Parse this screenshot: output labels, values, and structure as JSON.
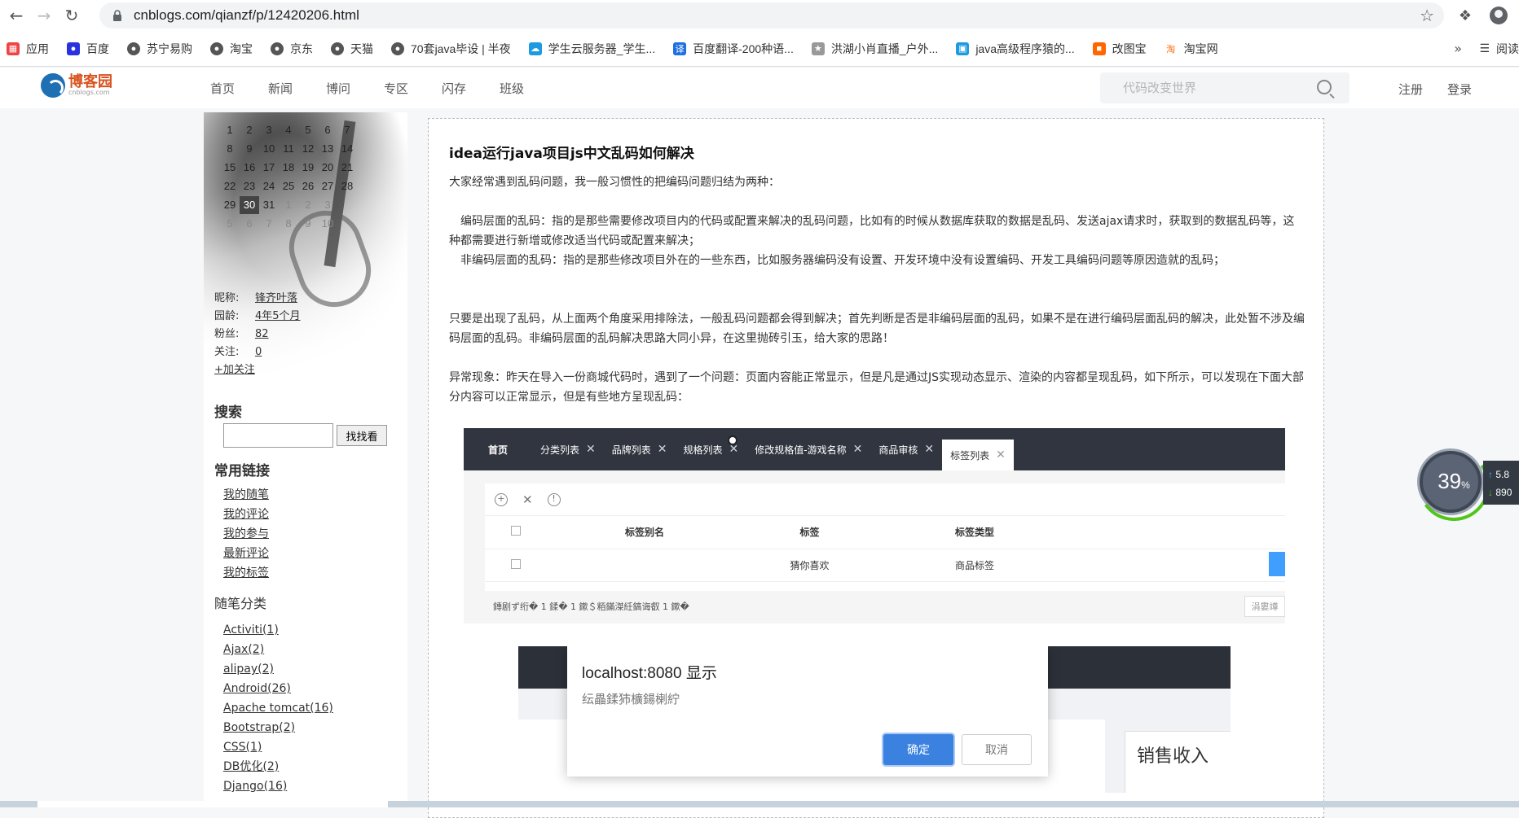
{
  "browser": {
    "url": "cnblogs.com/qianzf/p/12420206.html",
    "bookmarks": [
      {
        "label": "应用",
        "color": "#e44"
      },
      {
        "label": "百度",
        "color": "#2932e1"
      },
      {
        "label": "苏宁易购",
        "color": "#555"
      },
      {
        "label": "淘宝",
        "color": "#555"
      },
      {
        "label": "京东",
        "color": "#555"
      },
      {
        "label": "天猫",
        "color": "#555"
      },
      {
        "label": "70套java毕设 | 半夜",
        "color": "#555"
      },
      {
        "label": "学生云服务器_学生...",
        "color": "#1e9be0"
      },
      {
        "label": "百度翻译-200种语...",
        "color": "#1e6fe0"
      },
      {
        "label": "洪湖小肖直播_户外...",
        "color": "#999"
      },
      {
        "label": "java高级程序猿的...",
        "color": "#1e9be0"
      },
      {
        "label": "改图宝",
        "color": "#f60"
      },
      {
        "label": "淘宝网",
        "color": "#f60"
      }
    ],
    "more": "»",
    "reading_list": "阅读"
  },
  "site": {
    "logo_cn": "博客园",
    "logo_en": "cnblogs.com",
    "nav": [
      "首页",
      "新闻",
      "博问",
      "专区",
      "闪存",
      "班级"
    ],
    "search_placeholder": "代码改变世界",
    "register": "注册",
    "login": "登录"
  },
  "sidebar": {
    "calendar": [
      [
        "1",
        "2",
        "3",
        "4",
        "5",
        "6",
        "7"
      ],
      [
        "8",
        "9",
        "10",
        "11",
        "12",
        "13",
        "14"
      ],
      [
        "15",
        "16",
        "17",
        "18",
        "19",
        "20",
        "21"
      ],
      [
        "22",
        "23",
        "24",
        "25",
        "26",
        "27",
        "28"
      ],
      [
        "29",
        "30",
        "31",
        "1",
        "2",
        "3",
        ""
      ],
      [
        "5",
        "6",
        "7",
        "8",
        "9",
        "10",
        ""
      ]
    ],
    "today": "30",
    "profile": {
      "nickname_label": "昵称:",
      "nickname": "锋齐叶落",
      "age_label": "园龄:",
      "age": "4年5个月",
      "fans_label": "粉丝:",
      "fans": "82",
      "follow_label": "关注:",
      "follow": "0",
      "add_follow": "+加关注"
    },
    "search_title": "搜索",
    "search_button": "找找看",
    "common_links_title": "常用链接",
    "common_links": [
      "我的随笔",
      "我的评论",
      "我的参与",
      "最新评论",
      "我的标签"
    ],
    "categories_title": "随笔分类",
    "categories": [
      "Activiti(1)",
      "Ajax(2)",
      "alipay(2)",
      "Android(26)",
      "Apache tomcat(16)",
      "Bootstrap(2)",
      "CSS(1)",
      "DB优化(2)",
      "Django(16)"
    ]
  },
  "post": {
    "title": "idea运行java项目js中文乱码如何解决",
    "p1": "大家经常遇到乱码问题，我一般习惯性的把编码问题归结为两种：",
    "p2": "　编码层面的乱码：指的是那些需要修改项目内的代码或配置来解决的乱码问题，比如有的时候从数据库获取的数据是乱码、发送ajax请求时，获取到的数据乱码等，这种都需要进行新增或修改适当代码或配置来解决；",
    "p3": "　非编码层面的乱码：指的是那些修改项目外在的一些东西，比如服务器编码没有设置、开发环境中没有设置编码、开发工具编码问题等原因造就的乱码；",
    "p4": "只要是出现了乱码，从上面两个角度采用排除法，一般乱码问题都会得到解决；首先判断是否是非编码层面的乱码，如果不是在进行编码层面乱码的解决，此处暂不涉及编码层面的乱码。非编码层面的乱码解决思路大同小异，在这里抛砖引玉，给大家的思路！",
    "p5": "异常现象：昨天在导入一份商城代码时，遇到了一个问题：页面内容能正常显示，但是凡是通过JS实现动态显示、渲染的内容都呈现乱码，如下所示，可以发现在下面大部分内容可以正常显示，但是有些地方呈现乱码："
  },
  "screenshot1": {
    "home": "首页",
    "tabs": [
      "分类列表",
      "品牌列表",
      "规格列表",
      "修改规格值-游戏名称",
      "商品审核"
    ],
    "active_tab": "标签列表",
    "headers": [
      "标签别名",
      "标签",
      "标签类型"
    ],
    "row": [
      "",
      "猜你喜欢",
      "商品标签"
    ],
    "footer_text": "鏄剧ず绗� 1 鍒� 1 鏉＄粨鏋滐紝鎬诲叡 1 鏉�",
    "pager": "涓婁竴"
  },
  "screenshot2": {
    "dialog_title": "localhost:8080 显示",
    "dialog_msg": "纭畾鍒犻櫎鍚楋紵",
    "ok": "确定",
    "cancel": "取消",
    "card_text": "销售收入"
  },
  "speed_widget": {
    "percent": "39",
    "percent_unit": "%",
    "up": "5.8",
    "down": "890"
  }
}
